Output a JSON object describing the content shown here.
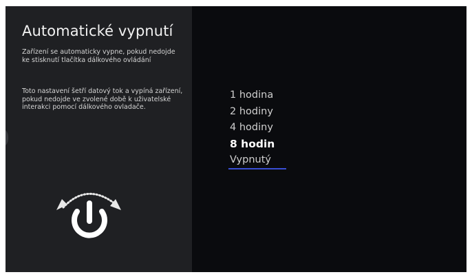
{
  "dialog": {
    "title": "Automatické vypnutí",
    "description_1": "Zařízení se automaticky vypne, pokud nedojde ke stisknutí tlačítka dálkového ovládání",
    "description_2": "Toto nastavení šetří datový tok a vypíná zařízení, pokud nedojde ve zvolené době k uživatelské interakci pomocí dálkového ovladače."
  },
  "illustration": {
    "icon": "power-timer-icon"
  },
  "options": {
    "items": [
      {
        "label": "1 hodina",
        "selected": false
      },
      {
        "label": "2 hodiny",
        "selected": false
      },
      {
        "label": "4 hodiny",
        "selected": false
      },
      {
        "label": "8 hodin",
        "selected": true
      },
      {
        "label": "Vypnutý",
        "selected": false
      }
    ]
  },
  "colors": {
    "background": "#0a0b0e",
    "panel": "#1f2023",
    "accent": "#3a4fd6",
    "text": "#f2f2f2"
  }
}
